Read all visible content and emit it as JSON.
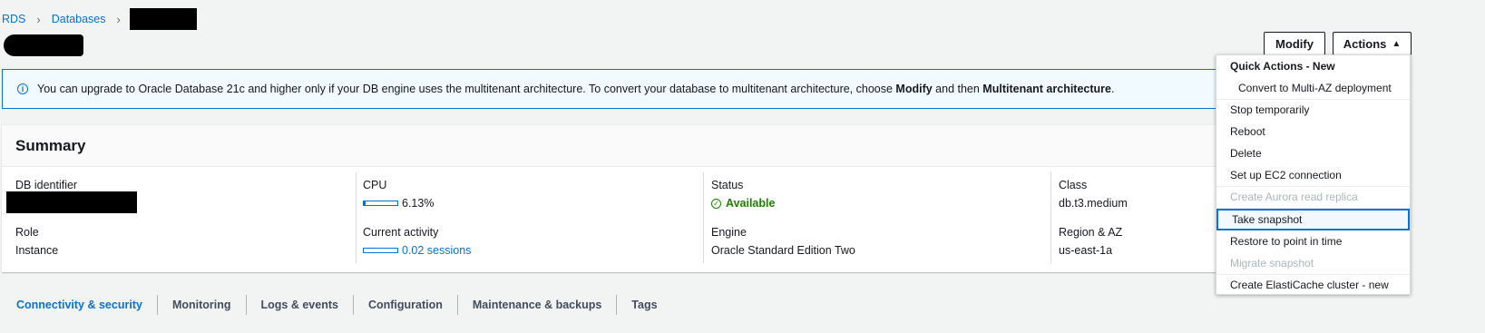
{
  "breadcrumb": {
    "root": "RDS",
    "databases": "Databases"
  },
  "header": {
    "modify_label": "Modify",
    "actions_label": "Actions"
  },
  "alert": {
    "text_before": "You can upgrade to Oracle Database 21c and higher only if your DB engine uses the multitenant architecture. To convert your database to multitenant architecture, choose ",
    "bold1": "Modify",
    "text_mid": " and then ",
    "bold2": "Multitenant architecture",
    "text_end": "."
  },
  "summary": {
    "title": "Summary",
    "db_identifier_label": "DB identifier",
    "role_label": "Role",
    "role_value": "Instance",
    "cpu_label": "CPU",
    "cpu_value": "6.13%",
    "cpu_fraction": 0.0613,
    "activity_label": "Current activity",
    "activity_value": "0.02 sessions",
    "status_label": "Status",
    "status_value": "Available",
    "engine_label": "Engine",
    "engine_value": "Oracle Standard Edition Two",
    "class_label": "Class",
    "class_value": "db.t3.medium",
    "region_label": "Region & AZ",
    "region_value": "us-east-1a"
  },
  "tabs": [
    "Connectivity & security",
    "Monitoring",
    "Logs & events",
    "Configuration",
    "Maintenance & backups",
    "Tags"
  ],
  "actions_menu": {
    "group_title": "Quick Actions - New",
    "convert_multi_az": "Convert to Multi-AZ deployment",
    "stop_temporarily": "Stop temporarily",
    "reboot": "Reboot",
    "delete": "Delete",
    "setup_ec2": "Set up EC2 connection",
    "create_aurora_replica": "Create Aurora read replica",
    "take_snapshot": "Take snapshot",
    "restore_point_in_time": "Restore to point in time",
    "migrate_snapshot": "Migrate snapshot",
    "create_elasticache": "Create ElastiCache cluster - new"
  },
  "colors": {
    "accent": "#0972d3",
    "success": "#1d8102",
    "disabled": "#aab7b8"
  }
}
